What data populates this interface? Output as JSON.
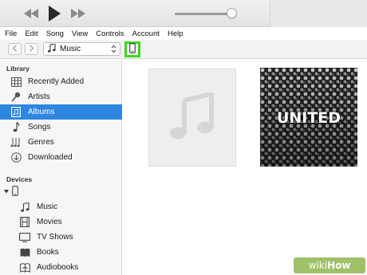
{
  "playback": {
    "buttons": [
      "rewind-icon",
      "play-icon",
      "fast-forward-icon"
    ],
    "volume_level": 0.95
  },
  "menubar": {
    "items": [
      "File",
      "Edit",
      "Song",
      "View",
      "Controls",
      "Account",
      "Help"
    ]
  },
  "toolbar": {
    "back_icon": "chevron-left-icon",
    "forward_icon": "chevron-right-icon",
    "media_type": "Music",
    "device_icon": "iphone-icon",
    "highlight_color": "#38d91a"
  },
  "sidebar": {
    "library_header": "Library",
    "library_items": [
      {
        "label": "Recently Added",
        "icon": "grid-icon"
      },
      {
        "label": "Artists",
        "icon": "microphone-icon"
      },
      {
        "label": "Albums",
        "icon": "album-icon",
        "selected": true
      },
      {
        "label": "Songs",
        "icon": "note-icon"
      },
      {
        "label": "Genres",
        "icon": "genres-icon"
      },
      {
        "label": "Downloaded",
        "icon": "download-icon"
      }
    ],
    "devices_header": "Devices",
    "device_items": [
      {
        "label": "Music",
        "icon": "note-icon"
      },
      {
        "label": "Movies",
        "icon": "film-icon"
      },
      {
        "label": "TV Shows",
        "icon": "tv-icon"
      },
      {
        "label": "Books",
        "icon": "book-icon"
      },
      {
        "label": "Audiobooks",
        "icon": "audiobook-icon"
      }
    ],
    "selection_color": "#2e86e0"
  },
  "albums": [
    {
      "artwork": "placeholder-note"
    },
    {
      "artwork": "crowd-photo",
      "art_text": "UNITED"
    }
  ],
  "watermark": {
    "part1": "wiki",
    "part2": "How"
  }
}
